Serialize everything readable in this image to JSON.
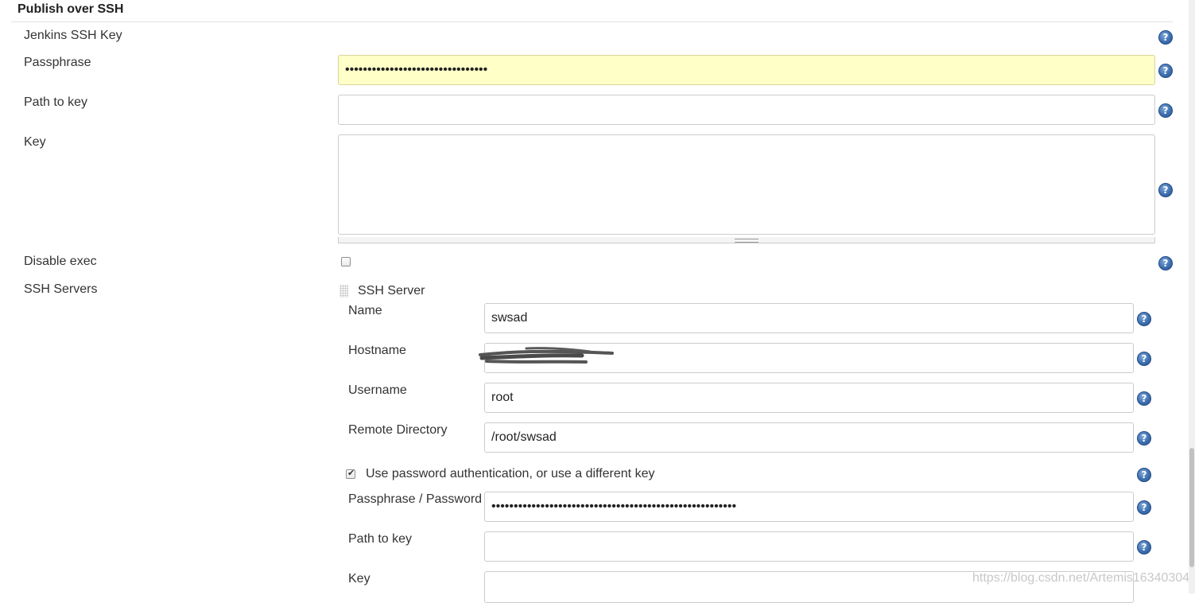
{
  "section": {
    "title": "Publish over SSH"
  },
  "jenkins_key": {
    "label": "Jenkins SSH Key",
    "passphrase_label": "Passphrase",
    "passphrase_value": "••••••••••••••••••••••••••••••••",
    "path_label": "Path to key",
    "path_value": "",
    "key_label": "Key",
    "key_value": "",
    "disable_exec_label": "Disable exec",
    "disable_exec_checked": false
  },
  "ssh_servers": {
    "label": "SSH Servers",
    "server_header": "SSH Server",
    "name_label": "Name",
    "name_value": "swsad",
    "hostname_label": "Hostname",
    "hostname_value": "",
    "username_label": "Username",
    "username_value": "root",
    "remote_dir_label": "Remote Directory",
    "remote_dir_value": "/root/swsad",
    "use_password_label": "Use password authentication, or use a different key",
    "use_password_checked": true,
    "passphrase_label": "Passphrase / Password",
    "passphrase_value": "•••••••••••••••••••••••••••••••••••••••••••••••••••••••",
    "path_label": "Path to key",
    "path_value": "",
    "key_label": "Key",
    "key_value": ""
  },
  "help_icon_glyph": "?",
  "watermark": "https://blog.csdn.net/Artemis16340304",
  "colors": {
    "highlight_field": "#ffffc8",
    "help_icon": "#3d6fb0"
  }
}
